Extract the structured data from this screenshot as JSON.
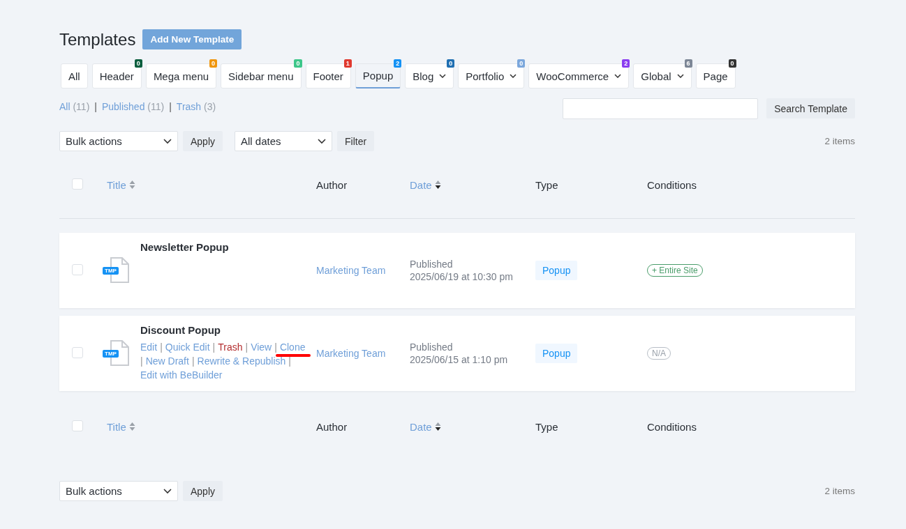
{
  "page_title": "Templates",
  "add_button": "Add New Template",
  "tabs": [
    {
      "label": "All",
      "selected": false,
      "dropdown": false
    },
    {
      "label": "Header",
      "selected": false,
      "dropdown": false,
      "badge": "0",
      "color": "#0b5e3e"
    },
    {
      "label": "Mega menu",
      "selected": false,
      "dropdown": false,
      "badge": "0",
      "color": "#f0960e"
    },
    {
      "label": "Sidebar menu",
      "selected": false,
      "dropdown": false,
      "badge": "0",
      "color": "#3ec78a"
    },
    {
      "label": "Footer",
      "selected": false,
      "dropdown": false,
      "badge": "1",
      "color": "#e0392f"
    },
    {
      "label": "Popup",
      "selected": true,
      "dropdown": false,
      "badge": "2",
      "color": "#1592f4"
    },
    {
      "label": "Blog",
      "selected": false,
      "dropdown": true,
      "badge": "0",
      "color": "#1f6fb2"
    },
    {
      "label": "Portfolio",
      "selected": false,
      "dropdown": true,
      "badge": "0",
      "color": "#7ba7dc"
    },
    {
      "label": "WooCommerce",
      "selected": false,
      "dropdown": true,
      "badge": "2",
      "color": "#8a3df0"
    },
    {
      "label": "Global",
      "selected": false,
      "dropdown": true,
      "badge": "6",
      "color": "#7d8796"
    },
    {
      "label": "Page",
      "selected": false,
      "dropdown": false,
      "badge": "0",
      "color": "#333333"
    }
  ],
  "status_filters": [
    {
      "label": "All",
      "count": "(11)"
    },
    {
      "label": "Published",
      "count": "(11)"
    },
    {
      "label": "Trash",
      "count": "(3)"
    }
  ],
  "separator": "|",
  "search": {
    "button": "Search Template"
  },
  "top_controls": {
    "bulk": "Bulk actions",
    "apply": "Apply",
    "dates": "All dates",
    "filter": "Filter",
    "count": "2 items"
  },
  "header": {
    "select_all_checked": false,
    "columns": [
      {
        "label": "Title",
        "sortable": true,
        "sorted": false
      },
      {
        "label": "Author",
        "sortable": false
      },
      {
        "label": "Date",
        "sortable": true,
        "sorted": true
      },
      {
        "label": "Type",
        "sortable": false
      },
      {
        "label": "Conditions",
        "sortable": false
      }
    ]
  },
  "rows": [
    {
      "title": "Newsletter Popup",
      "icon_label": "TMP",
      "checked": false,
      "actions": [],
      "author": "Marketing Team",
      "status": "Published",
      "date": "2025/06/19 at 10:30 pm",
      "type": "Popup",
      "condition": {
        "label": "+ Entire Site",
        "kind": "active"
      }
    },
    {
      "title": "Discount Popup",
      "icon_label": "TMP",
      "checked": false,
      "actions": [
        {
          "label": "Edit",
          "kind": "link",
          "highlighted": false
        },
        {
          "label": "Quick Edit",
          "kind": "link",
          "highlighted": false
        },
        {
          "label": "Trash",
          "kind": "danger",
          "highlighted": false
        },
        {
          "label": "View",
          "kind": "link",
          "highlighted": false
        },
        {
          "label": "Clone",
          "kind": "link",
          "highlighted": true
        },
        {
          "label": "New Draft",
          "kind": "link",
          "highlighted": false
        },
        {
          "label": "Rewrite & Republish",
          "kind": "link",
          "highlighted": false
        },
        {
          "label": "Edit with BeBuilder",
          "kind": "link",
          "highlighted": false
        }
      ],
      "author": "Marketing Team",
      "status": "Published",
      "date": "2025/06/15 at 1:10 pm",
      "type": "Popup",
      "condition": {
        "label": "N/A",
        "kind": "none"
      }
    }
  ],
  "footer": {
    "select_all_checked": false,
    "columns": [
      {
        "label": "Title",
        "sortable": true,
        "sorted": false
      },
      {
        "label": "Author",
        "sortable": false
      },
      {
        "label": "Date",
        "sortable": true,
        "sorted": true
      },
      {
        "label": "Type",
        "sortable": false
      },
      {
        "label": "Conditions",
        "sortable": false
      }
    ]
  },
  "bottom_controls": {
    "bulk": "Bulk actions",
    "apply": "Apply",
    "count": "2 items"
  }
}
